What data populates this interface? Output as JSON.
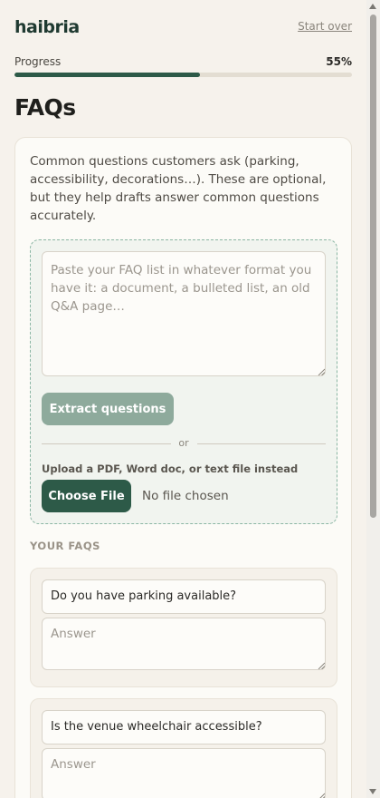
{
  "header": {
    "logo": "haibria",
    "start_over": "Start over"
  },
  "progress": {
    "label": "Progress",
    "percent_text": "55%",
    "value": 55
  },
  "page": {
    "title": "FAQs",
    "intro": "Common questions customers ask (parking, accessibility, decorations…). These are optional, but they help drafts answer common questions accurately."
  },
  "import": {
    "paste_placeholder": "Paste your FAQ list in whatever format you have it: a document, a bulleted list, an old Q&A page…",
    "extract_label": "Extract questions",
    "or_label": "or",
    "upload_label": "Upload a PDF, Word doc, or text file instead",
    "choose_file_label": "Choose File",
    "file_status": "No file chosen"
  },
  "faqs": {
    "section_label": "YOUR FAQS",
    "answer_placeholder": "Answer",
    "items": [
      {
        "question": "Do you have parking available?",
        "answer": ""
      },
      {
        "question": "Is the venue wheelchair accessible?",
        "answer": ""
      }
    ]
  },
  "colors": {
    "accent": "#2d5a48",
    "accent_disabled": "#8eaa9c",
    "background": "#f6f2ec"
  }
}
